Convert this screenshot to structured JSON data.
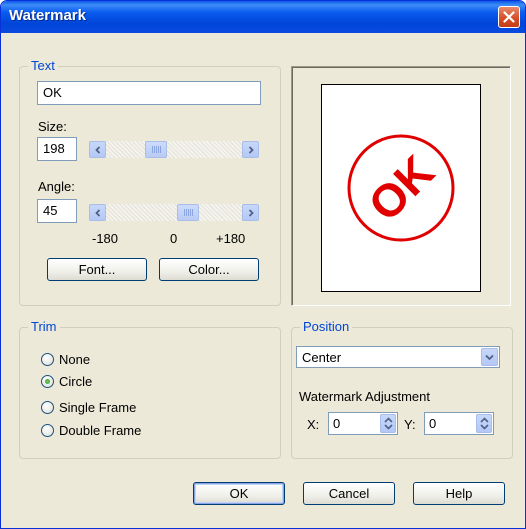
{
  "window": {
    "title": "Watermark"
  },
  "text_group": {
    "legend": "Text",
    "text_value": "OK",
    "size_label": "Size:",
    "size_value": "198",
    "angle_label": "Angle:",
    "angle_value": "45",
    "scale_min": "-180",
    "scale_mid": "0",
    "scale_max": "+180",
    "font_button": "Font...",
    "color_button": "Color..."
  },
  "preview": {
    "watermark_text": "OK",
    "watermark_color": "#e00000",
    "angle_degrees": 45
  },
  "trim_group": {
    "legend": "Trim",
    "options": [
      "None",
      "Circle",
      "Single Frame",
      "Double Frame"
    ],
    "selected": "Circle"
  },
  "position_group": {
    "legend": "Position",
    "selected": "Center",
    "adjustment_label": "Watermark Adjustment",
    "x_label": "X:",
    "x_value": "0",
    "y_label": "Y:",
    "y_value": "0"
  },
  "footer": {
    "ok": "OK",
    "cancel": "Cancel",
    "help": "Help"
  },
  "colors": {
    "title_bar": "#0a5df0",
    "close_button": "#d4502a",
    "legend_text": "#0046d5"
  }
}
